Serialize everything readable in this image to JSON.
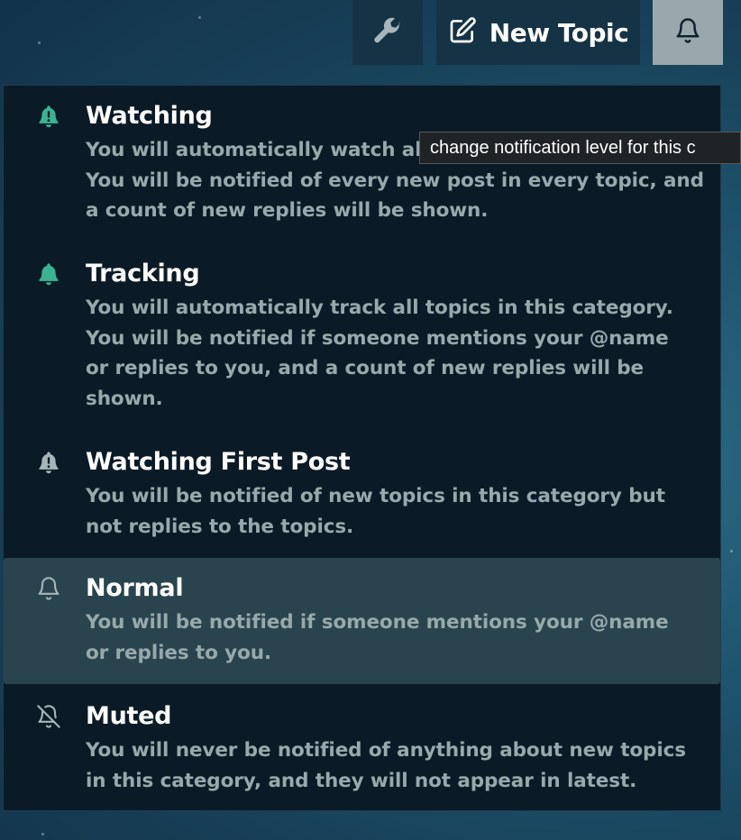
{
  "toolbar": {
    "wrench_icon": "wrench-icon",
    "new_topic_icon": "edit-icon",
    "new_topic_label": "New Topic",
    "notifications_icon": "bell-icon"
  },
  "tooltip": {
    "text": "change notification level for this c"
  },
  "notification_menu": {
    "items": [
      {
        "title": "Watching",
        "icon": "bell-exclamation-icon",
        "icon_color": "#3ab393",
        "lines": [
          "You will automatically watch all topics in this category.",
          "You will be notified of every new post in every topic, and",
          "a count of new replies will be shown."
        ],
        "selected": false
      },
      {
        "title": "Tracking",
        "icon": "bell-icon",
        "icon_color": "#3ab393",
        "lines": [
          "You will automatically track all topics in this category.",
          "You will be notified if someone mentions your @name",
          "or replies to you, and a count of new replies will be",
          "shown."
        ],
        "selected": false
      },
      {
        "title": "Watching First Post",
        "icon": "bell-exclamation-icon",
        "icon_color": "#a6b5b8",
        "lines": [
          "You will be notified of new topics in this category but",
          "not replies to the topics."
        ],
        "selected": false
      },
      {
        "title": "Normal",
        "icon": "bell-outline-icon",
        "icon_color": "#a6b5b8",
        "lines": [
          "You will be notified if someone mentions your @name",
          "or replies to you."
        ],
        "selected": true
      },
      {
        "title": "Muted",
        "icon": "bell-slash-icon",
        "icon_color": "#a6b5b8",
        "lines": [
          "You will never be notified of anything about new topics",
          "in this category, and they will not appear in latest."
        ],
        "selected": false
      }
    ]
  }
}
